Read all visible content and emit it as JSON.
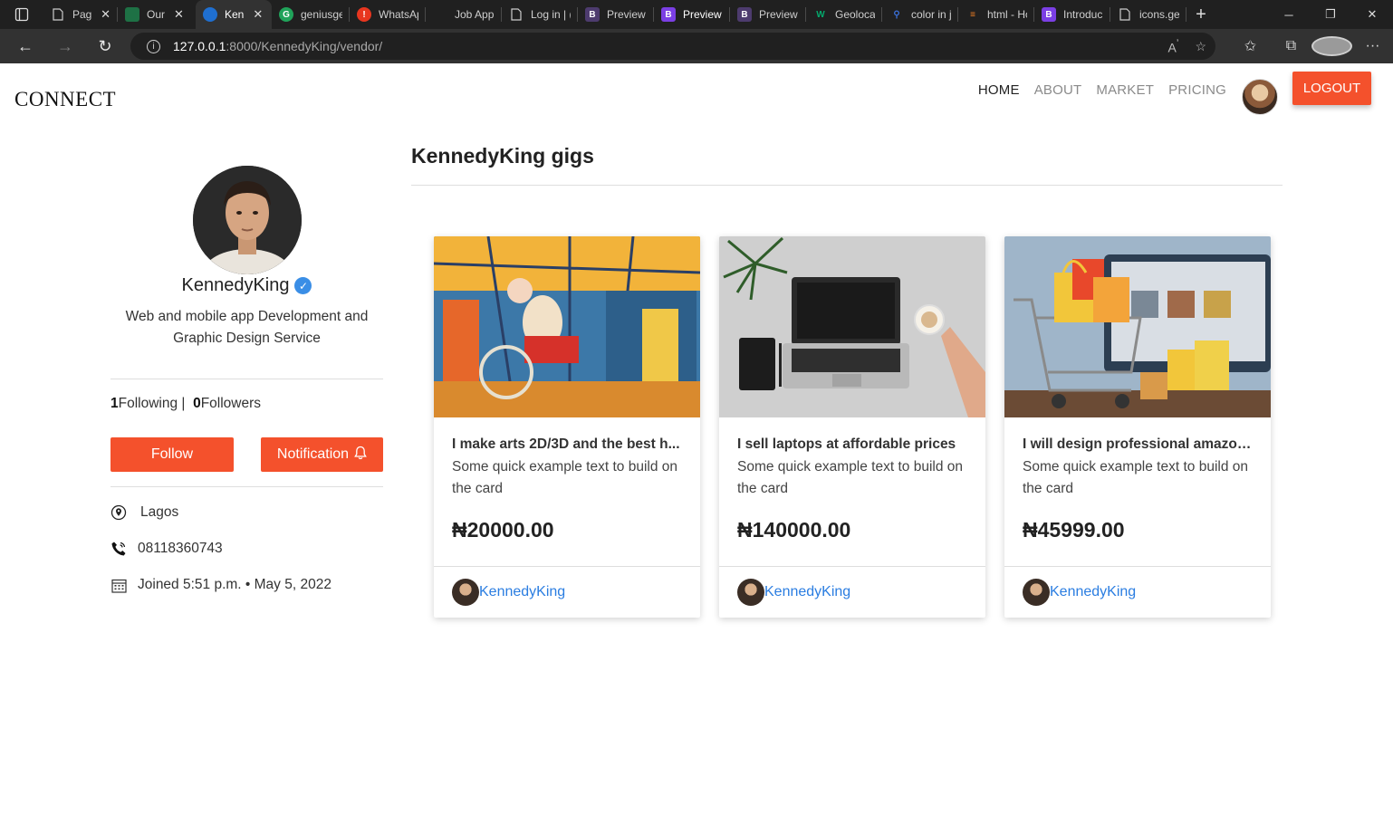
{
  "browser": {
    "tabs": [
      {
        "label": "Pag",
        "favicon": "page-icon",
        "closable": true
      },
      {
        "label": "Our",
        "favicon": "sheet-icon",
        "closable": true
      },
      {
        "label": "Ken",
        "favicon": "edge-icon",
        "closable": true,
        "active": true
      },
      {
        "label": "geniusge",
        "favicon": "genius-icon"
      },
      {
        "label": "WhatsAp",
        "favicon": "whatsapp-icon"
      },
      {
        "label": "Job Appl",
        "favicon": "job-icon"
      },
      {
        "label": "Log in | (",
        "favicon": "page-icon"
      },
      {
        "label": "Preview",
        "favicon": "bootstrap-icon"
      },
      {
        "label": "Preview",
        "favicon": "bootstrap-icon"
      },
      {
        "label": "Preview",
        "favicon": "bootstrap-icon"
      },
      {
        "label": "Geolocat",
        "favicon": "w3-icon"
      },
      {
        "label": "color in j",
        "favicon": "search-icon"
      },
      {
        "label": "html - Ho",
        "favicon": "stackoverflow-icon"
      },
      {
        "label": "Introduc",
        "favicon": "bootstrap-icon"
      },
      {
        "label": "icons.get",
        "favicon": "page-icon"
      }
    ],
    "url_host": "127.0.0.1",
    "url_path": ":8000/KennedyKing/vendor/"
  },
  "site": {
    "brand": "CONNECT",
    "nav": [
      "HOME",
      "ABOUT",
      "MARKET",
      "PRICING"
    ],
    "logout_label": "LOGOUT",
    "accent_color": "#f4512c",
    "link_color": "#2a7de1"
  },
  "profile": {
    "username": "KennedyKing",
    "bio": "Web and mobile app Development and Graphic Design Service",
    "following_count": "1",
    "following_label": "Following |",
    "followers_count": "0",
    "followers_label": "Followers",
    "follow_label": "Follow",
    "notification_label": "Notification",
    "location": "Lagos",
    "phone": "08118360743",
    "joined": "Joined 5:51 p.m. • May 5, 2022"
  },
  "gigs": {
    "heading": "KennedyKing gigs",
    "cards": [
      {
        "title": "I make arts 2D/3D and the best h...",
        "text": "Some quick example text to build on the card",
        "price": "₦20000.00",
        "seller": "KennedyKing"
      },
      {
        "title": "I sell laptops at affordable prices",
        "text": "Some quick example text to build on the card",
        "price": "₦140000.00",
        "seller": "KennedyKing"
      },
      {
        "title": "I will design professional amazon...",
        "text": "Some quick example text to build on the card",
        "price": "₦45999.00",
        "seller": "KennedyKing"
      }
    ]
  }
}
